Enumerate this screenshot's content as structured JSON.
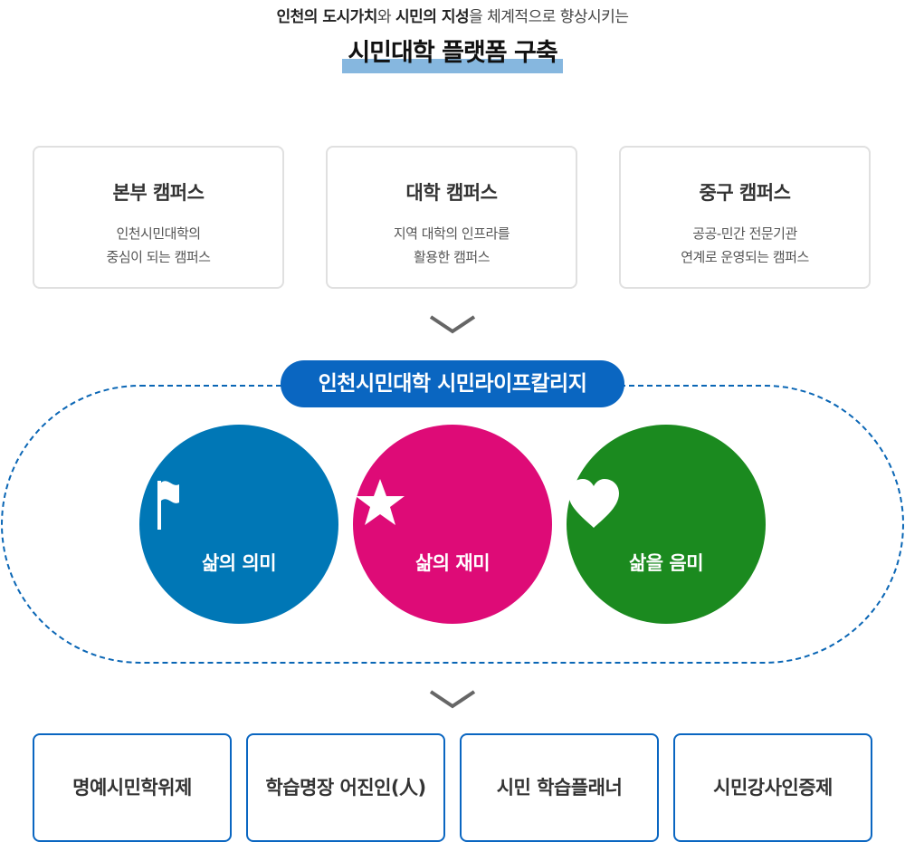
{
  "header": {
    "subtitle": {
      "part1": "인천의 도시가치",
      "part2": "와 ",
      "part3": "시민의 지성",
      "part4": "을 체계적으로 향상시키는"
    },
    "title": "시민대학 플랫폼 구축"
  },
  "campuses": [
    {
      "name": "본부 캠퍼스",
      "desc_line1": "인천시민대학의",
      "desc_line2": "중심이 되는 캠퍼스"
    },
    {
      "name": "대학 캠퍼스",
      "desc_line1": "지역 대학의 인프라를",
      "desc_line2": "활용한 캠퍼스"
    },
    {
      "name": "중구 캠퍼스",
      "desc_line1": "공공-민간 전문기관",
      "desc_line2": "연계로 운영되는 캠퍼스"
    }
  ],
  "college": {
    "title": "인천시민대학 시민라이프칼리지",
    "values": [
      {
        "label": "삶의 의미",
        "icon": "flag-icon",
        "color": "#0077b6"
      },
      {
        "label": "삶의 재미",
        "icon": "star-icon",
        "color": "#de0b77"
      },
      {
        "label": "삶을 음미",
        "icon": "heart-icon",
        "color": "#1b8a1f"
      }
    ]
  },
  "programs": [
    "명예시민학위제",
    "학습명장 어진인(人)",
    "시민 학습플래너",
    "시민강사인증제"
  ],
  "colors": {
    "accent_blue": "#0a66c1",
    "highlight": "#86b7df"
  }
}
